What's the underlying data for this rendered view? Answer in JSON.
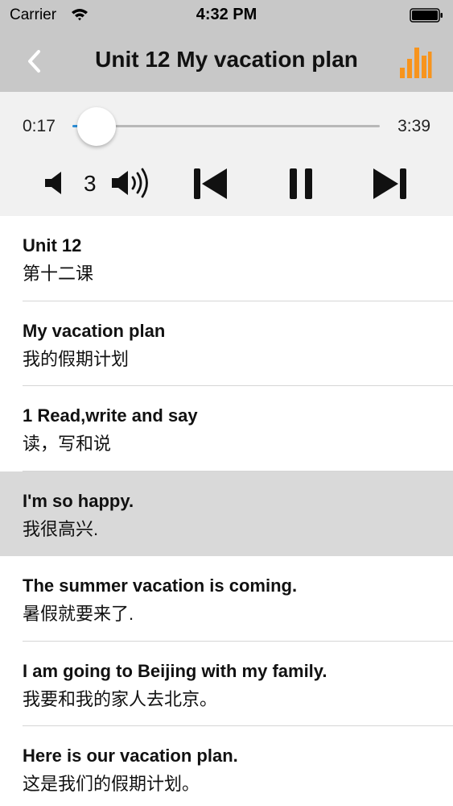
{
  "status_bar": {
    "carrier": "Carrier",
    "time": "4:32 PM",
    "icons": [
      "wifi-icon",
      "battery-icon"
    ]
  },
  "nav": {
    "title": "Unit 12 My vacation plan",
    "back_icon": "chevron-left-icon",
    "action_icon": "bars-chart-icon",
    "accent_color": "#f7941d"
  },
  "player": {
    "current_time": "0:17",
    "total_time": "3:39",
    "progress": 0.078,
    "progress_color": "#2d8fd8",
    "volume_level": "3",
    "icons": [
      "volume-down-icon",
      "volume-up-icon",
      "previous-track-icon",
      "pause-icon",
      "next-track-icon"
    ]
  },
  "lines": [
    {
      "en": "Unit 12",
      "zh": "第十二课",
      "active": false
    },
    {
      "en": "My vacation plan",
      "zh": "我的假期计划",
      "active": false
    },
    {
      "en": "1 Read,write and say",
      "zh": "读，写和说",
      "active": false
    },
    {
      "en": "I'm so happy.",
      "zh": "我很高兴.",
      "active": true
    },
    {
      "en": "The summer vacation  is coming.",
      "zh": "暑假就要来了.",
      "active": false
    },
    {
      "en": "I am going to Beijing with my family.",
      "zh": "我要和我的家人去北京。",
      "active": false
    },
    {
      "en": "Here is our vacation plan.",
      "zh": "这是我们的假期计划。",
      "active": false
    }
  ]
}
